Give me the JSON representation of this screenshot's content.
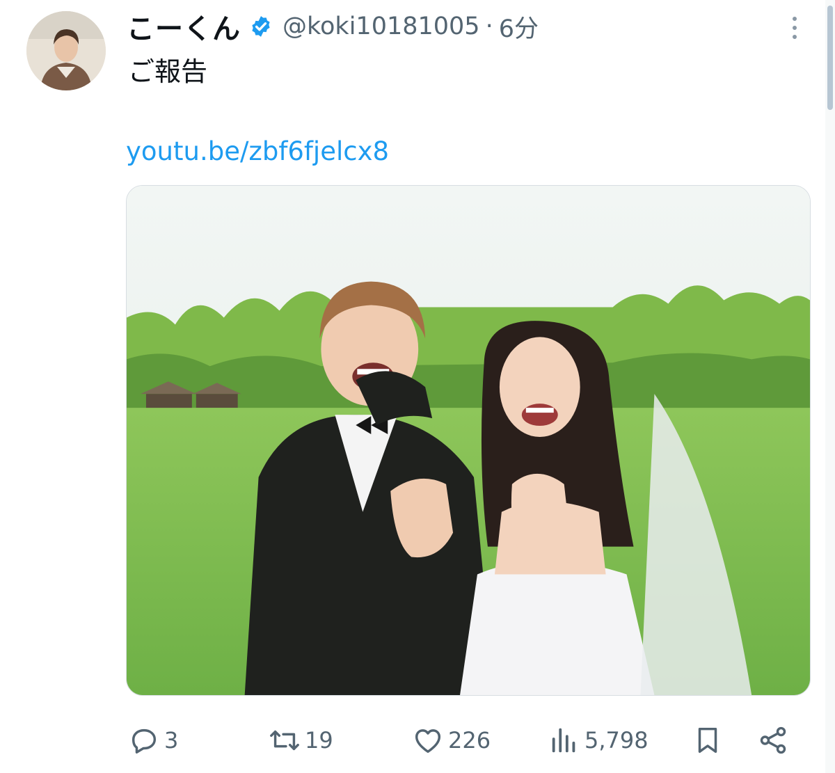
{
  "tweet": {
    "display_name": "こーくん",
    "handle": "@koki10181005",
    "separator": "·",
    "time": "6分",
    "text": "ご報告",
    "link": "youtu.be/zbf6fjelcx8"
  },
  "stats": {
    "replies": "3",
    "retweets": "19",
    "likes": "226",
    "views": "5,798"
  },
  "icons": {
    "verified": "verified-badge-icon",
    "more": "more-options-icon",
    "reply": "reply-icon",
    "retweet": "retweet-icon",
    "like": "heart-icon",
    "views": "views-bar-chart-icon",
    "bookmark": "bookmark-icon",
    "share": "share-icon"
  },
  "colors": {
    "link": "#1d9bf0",
    "verified": "#1d9bf0",
    "muted_text": "#536471",
    "main_text": "#0f1419"
  }
}
